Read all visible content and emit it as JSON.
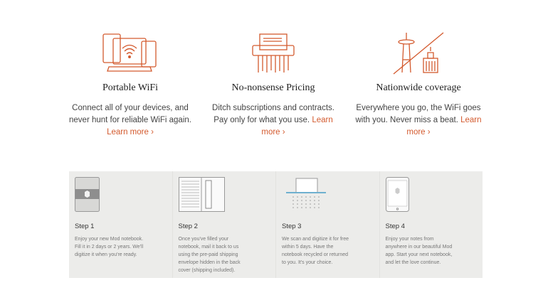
{
  "features": [
    {
      "title": "Portable WiFi",
      "text": "Connect all of your devices, and never hunt for reliable WiFi again.",
      "link": "Learn more ›",
      "icon": "devices-wifi-icon"
    },
    {
      "title": "No-nonsense Pricing",
      "text": "Ditch subscriptions and contracts. Pay only for what you use.",
      "link": "Learn more ›",
      "icon": "shredder-icon"
    },
    {
      "title": "Nationwide coverage",
      "text": "Everywhere you go, the WiFi goes with you. Never miss a beat.",
      "link": "Learn more ›",
      "icon": "city-skyline-icon"
    }
  ],
  "steps": [
    {
      "title": "Step 1",
      "text": "Enjoy your new Mod notebook. Fill it in 2 days or 2 years. We'll digitize it when you're ready.",
      "icon": "notebook-icon"
    },
    {
      "title": "Step 2",
      "text": "Once you've filled your notebook, mail it back to us using the pre-paid shipping envelope hidden in the back cover (shipping included).",
      "icon": "open-notebook-icon"
    },
    {
      "title": "Step 3",
      "text": "We scan and digitize it for free within 5 days. Have the notebook recycled or returned to you. It's your choice.",
      "icon": "scanner-icon"
    },
    {
      "title": "Step 4",
      "text": "Enjoy your notes from anywhere in our beautiful Mod app. Start your next notebook, and let the love continue.",
      "icon": "tablet-icon"
    }
  ],
  "colors": {
    "accent": "#d35a2e",
    "panel": "#ececea"
  }
}
